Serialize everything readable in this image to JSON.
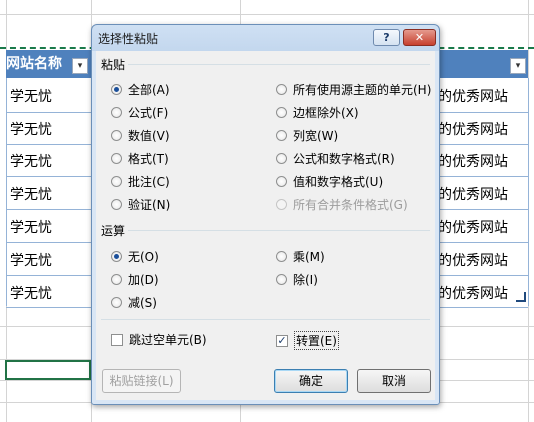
{
  "sheet": {
    "header": "网站名称",
    "rows_left": [
      "学无忧",
      "学无忧",
      "学无忧",
      "学无忧",
      "学无忧",
      "学无忧",
      "学无忧"
    ],
    "rows_right": [
      "的优秀网站",
      "的优秀网站",
      "的优秀网站",
      "的优秀网站",
      "的优秀网站",
      "的优秀网站",
      "的优秀网站"
    ],
    "filter_glyph": "▾"
  },
  "dialog": {
    "title": "选择性粘贴",
    "help_label": "?",
    "close_label": "✕",
    "paste_section": "粘贴",
    "paste_options_left": [
      "全部(A)",
      "公式(F)",
      "数值(V)",
      "格式(T)",
      "批注(C)",
      "验证(N)"
    ],
    "paste_options_right": [
      "所有使用源主题的单元(H)",
      "边框除外(X)",
      "列宽(W)",
      "公式和数字格式(R)",
      "值和数字格式(U)",
      "所有合并条件格式(G)"
    ],
    "paste_selected": "全部(A)",
    "operation_section": "运算",
    "operation_left": [
      "无(O)",
      "加(D)",
      "减(S)"
    ],
    "operation_right": [
      "乘(M)",
      "除(I)"
    ],
    "operation_selected": "无(O)",
    "skip_blanks": {
      "label": "跳过空单元(B)",
      "checked": false
    },
    "transpose": {
      "label": "转置(E)",
      "checked": true
    },
    "check_glyph": "✓",
    "paste_link": "粘贴链接(L)",
    "ok": "确定",
    "cancel": "取消"
  }
}
